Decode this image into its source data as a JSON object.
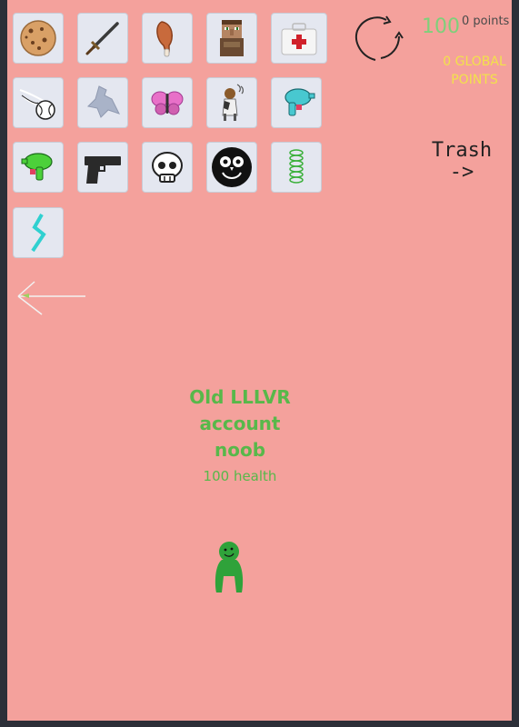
{
  "inventory": {
    "items": [
      {
        "icon": "cookie-icon"
      },
      {
        "icon": "sword-icon"
      },
      {
        "icon": "drumstick-icon"
      },
      {
        "icon": "villager-icon"
      },
      {
        "icon": "medkit-icon"
      },
      {
        "icon": "baseball-icon"
      },
      {
        "icon": "ghost-shape-icon"
      },
      {
        "icon": "butterfly-icon"
      },
      {
        "icon": "dog-icon"
      },
      {
        "icon": "blue-water-gun-icon"
      },
      {
        "icon": "green-water-gun-icon"
      },
      {
        "icon": "pistol-icon"
      },
      {
        "icon": "skull-icon"
      },
      {
        "icon": "owl-icon"
      },
      {
        "icon": "spring-icon"
      },
      {
        "icon": "lightning-icon"
      }
    ]
  },
  "hud": {
    "points": "0 points",
    "score": "100",
    "global_points_line1": "0 GLOBAL",
    "global_points_line2": "POINTS",
    "refresh_icon": "refresh-arrows-icon",
    "trash_line1": "Trash",
    "trash_line2": "->"
  },
  "back_icon": "back-arrow-icon",
  "player": {
    "name_line1": "Old LLLVR",
    "name_line2": "account",
    "name_line3": "noob",
    "health": "100 health",
    "color": "#2fa23a"
  },
  "colors": {
    "background": "#f4a19c",
    "green_text": "#58b84a",
    "yellow_text": "#f2e24a"
  }
}
